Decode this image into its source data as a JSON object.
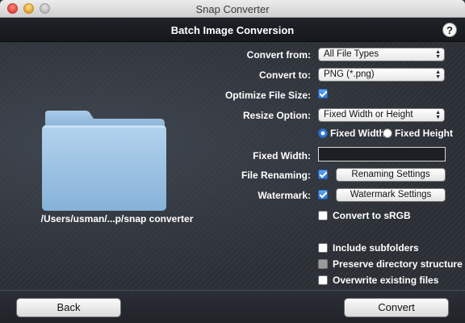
{
  "window": {
    "title": "Snap Converter"
  },
  "header": {
    "title": "Batch Image Conversion",
    "help_label": "?"
  },
  "source": {
    "path": "/Users/usman/...p/snap converter"
  },
  "form": {
    "convert_from": {
      "label": "Convert from:",
      "value": "All File Types"
    },
    "convert_to": {
      "label": "Convert to:",
      "value": "PNG (*.png)"
    },
    "optimize": {
      "label": "Optimize File Size:",
      "checked": true
    },
    "resize": {
      "label": "Resize Option:",
      "value": "Fixed Width or Height"
    },
    "resize_mode": {
      "fixed_width": "Fixed Width",
      "fixed_height": "Fixed Height",
      "selected": "fixed_width"
    },
    "fixed_width": {
      "label": "Fixed Width:",
      "value": ""
    },
    "renaming": {
      "label": "File Renaming:",
      "checked": true,
      "button": "Renaming Settings"
    },
    "watermark": {
      "label": "Watermark:",
      "checked": true,
      "button": "Watermark Settings"
    },
    "srgb": {
      "label": "Convert to sRGB",
      "checked": false
    },
    "subfolders": {
      "label": "Include subfolders",
      "checked": false
    },
    "preserve": {
      "label": "Preserve directory structure",
      "checked": false,
      "disabled": true
    },
    "overwrite": {
      "label": "Overwrite existing files",
      "checked": false
    }
  },
  "footer": {
    "back": "Back",
    "convert": "Convert"
  },
  "colors": {
    "accent": "#2d74d6",
    "background": "#2d3138",
    "header": "#1a1d21",
    "folder": "#8fb9dc"
  }
}
